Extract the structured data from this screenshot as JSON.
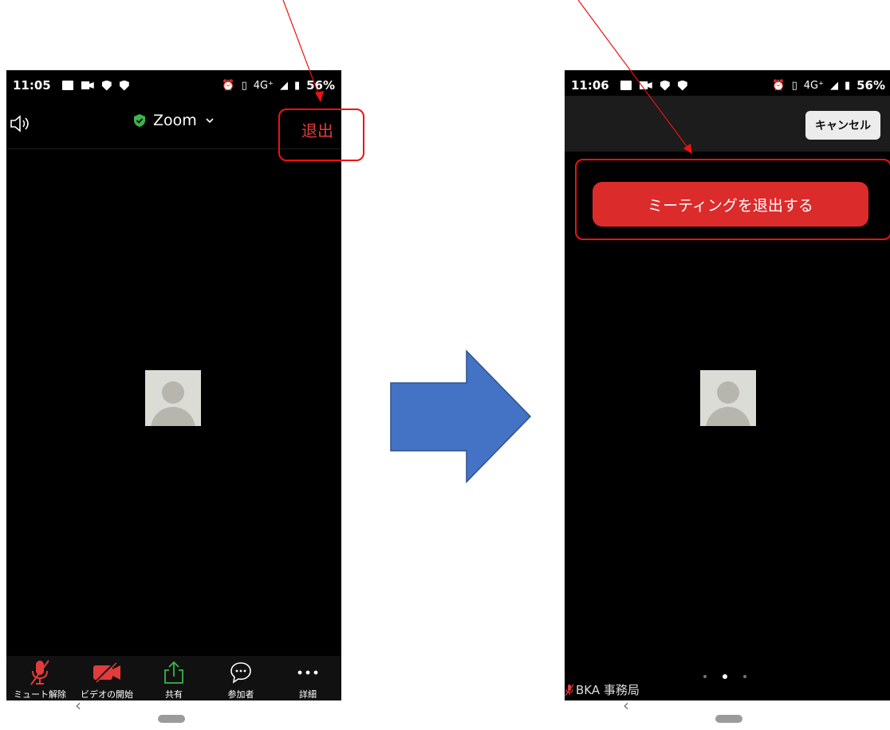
{
  "left_screen": {
    "status": {
      "time": "11:05",
      "network": "4G⁺",
      "battery": "56%"
    },
    "topbar": {
      "title": "Zoom",
      "exit_label": "退出"
    },
    "toolbar": [
      {
        "id": "unmute",
        "label": "ミュート解除",
        "icon": "mic-off-icon"
      },
      {
        "id": "start-video",
        "label": "ビデオの開始",
        "icon": "video-off-icon"
      },
      {
        "id": "share",
        "label": "共有",
        "icon": "share-icon"
      },
      {
        "id": "participants",
        "label": "参加者",
        "icon": "chat-bubble-icon"
      },
      {
        "id": "more",
        "label": "詳細",
        "icon": "more-icon"
      }
    ]
  },
  "right_screen": {
    "status": {
      "time": "11:06",
      "network": "4G⁺",
      "battery": "56%"
    },
    "cancel_label": "キャンセル",
    "leave_meeting_label": "ミーティングを退出する",
    "participant_name": "BKA 事務局"
  },
  "colors": {
    "exit_red": "#e33b3b",
    "leave_button": "#dc2b2b",
    "highlight_red": "#ee1111",
    "arrow_blue": "#4472c4",
    "share_green": "#3bb54a"
  }
}
